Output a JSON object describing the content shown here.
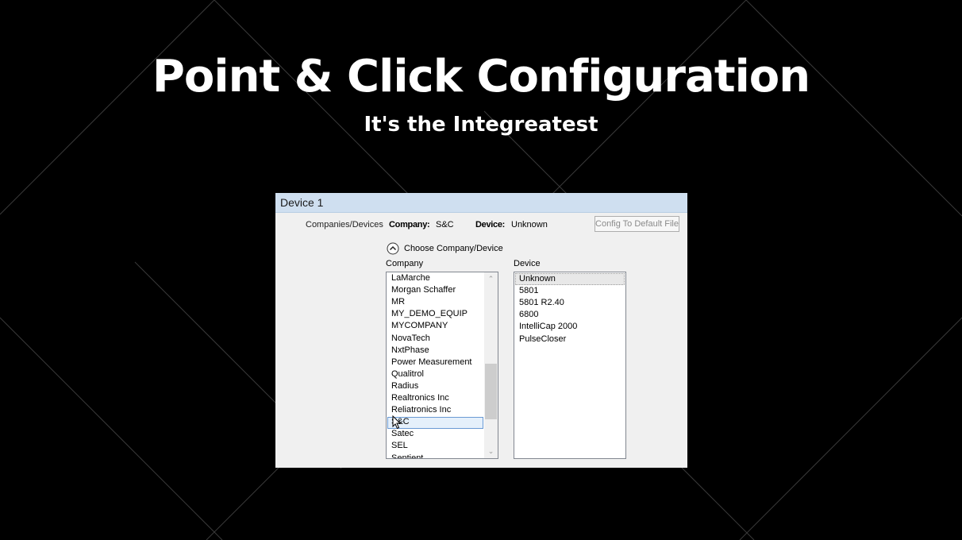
{
  "slide": {
    "title": "Point & Click Configuration",
    "subtitle": "It's the Integreatest"
  },
  "window": {
    "title": "Device 1",
    "companies_devices_label": "Companies/Devices",
    "company_label": "Company:",
    "company_value": "S&C",
    "device_label": "Device:",
    "device_value": "Unknown",
    "config_button": "Config To Default File",
    "choose_label": "Choose Company/Device",
    "company_column": "Company",
    "device_column": "Device"
  },
  "company_list": {
    "items": [
      "LaMarche",
      "Morgan Schaffer",
      "MR",
      "MY_DEMO_EQUIP",
      "MYCOMPANY",
      "NovaTech",
      "NxtPhase",
      "Power Measurement",
      "Qualitrol",
      "Radius",
      "Realtronics Inc",
      "Reliatronics Inc",
      "S&C",
      "Satec",
      "SEL",
      "Sentient"
    ],
    "selected": "S&C",
    "scroll_up_icon": "chevron-up-icon",
    "scroll_down_icon": "chevron-down-icon"
  },
  "device_list": {
    "items": [
      "Unknown",
      "5801",
      "5801 R2.40",
      "6800",
      "IntelliCap 2000",
      "PulseCloser"
    ],
    "selected": "Unknown"
  },
  "colors": {
    "background": "#000000",
    "title_bar": "#cfdff0",
    "window_bg": "#f0f0f0",
    "selection_border": "#6a9ad4"
  }
}
